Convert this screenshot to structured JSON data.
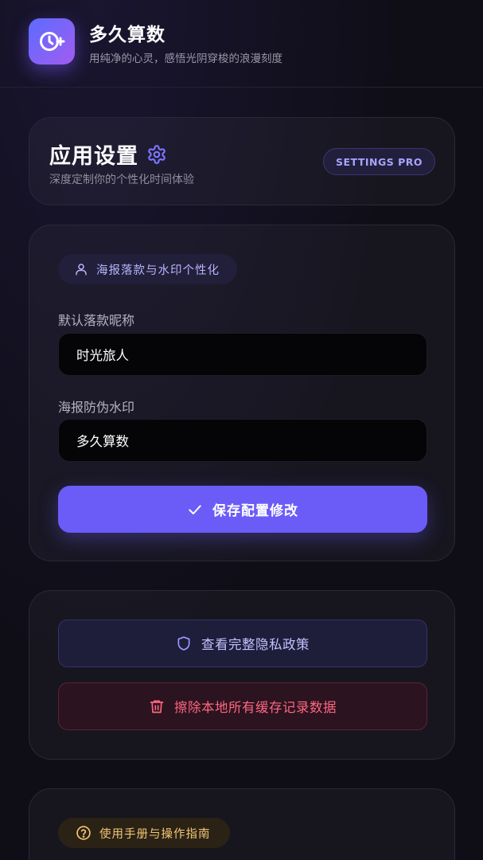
{
  "app": {
    "title": "多久算数",
    "subtitle": "用纯净的心灵，感悟光阴穿梭的浪漫刻度",
    "icon": "clock-plus-icon"
  },
  "settings_card": {
    "title": "应用设置",
    "subtitle": "深度定制你的个性化时间体验",
    "badge": "SETTINGS PRO",
    "icon": "gear-icon"
  },
  "poster_card": {
    "section_label": "海报落款与水印个性化",
    "nickname": {
      "label": "默认落款昵称",
      "value": "时光旅人"
    },
    "watermark": {
      "label": "海报防伪水印",
      "value": "多久算数"
    },
    "save_label": "保存配置修改"
  },
  "actions_card": {
    "privacy_label": "查看完整隐私政策",
    "clear_label": "擦除本地所有缓存记录数据"
  },
  "guide_card": {
    "section_label": "使用手册与操作指南"
  },
  "colors": {
    "accent": "#6b5cf8",
    "danger": "#ff6680",
    "warning": "#f3c874",
    "background": "#0f0e17"
  }
}
